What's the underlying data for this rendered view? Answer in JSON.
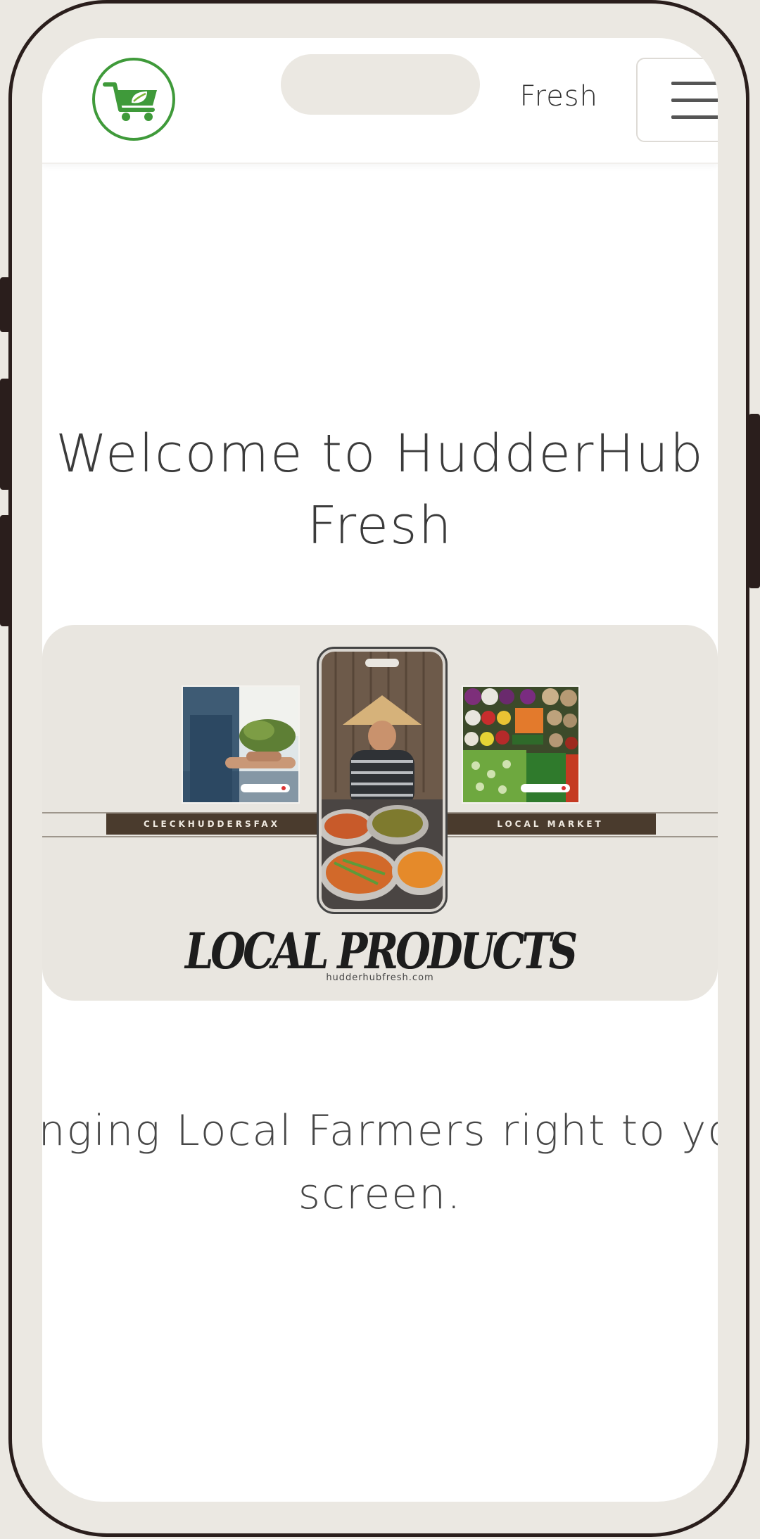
{
  "header": {
    "brand_visible_text": "Fresh",
    "logo_icon": "cart-leaf-icon",
    "menu_icon": "hamburger-icon",
    "colors": {
      "logo_green": "#3f9a3a",
      "leaf_green": "#7bb534"
    }
  },
  "hero": {
    "welcome_line1": "Welcome to HudderHub",
    "welcome_line2": "Fresh"
  },
  "banner": {
    "left_label": "CLECKHUDDERSFAX",
    "right_label": "LOCAL MARKET",
    "title": "LOCAL PRODUCTS",
    "url": "hudderhubfresh.com",
    "colors": {
      "band": "#4a3b2d",
      "background": "#e9e6e0"
    }
  },
  "tagline": {
    "line1": "inging Local Farmers right to yo",
    "line2": "screen."
  }
}
